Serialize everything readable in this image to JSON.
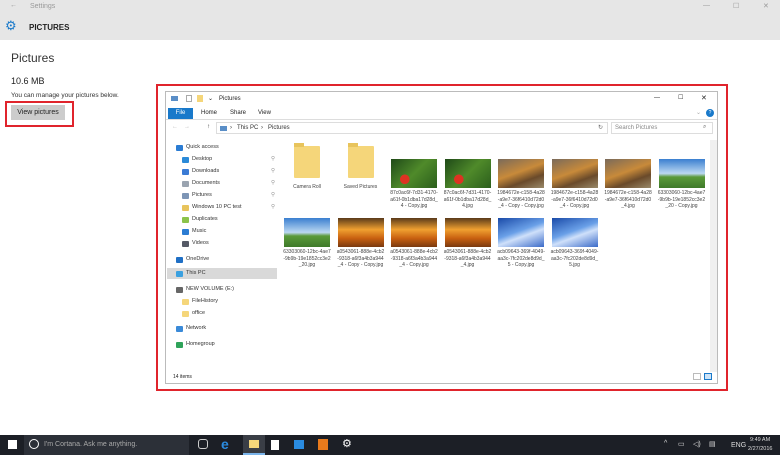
{
  "window": {
    "title": "Settings",
    "back_icon": "back-arrow-icon",
    "minimize": "—",
    "maximize": "☐",
    "close": "✕"
  },
  "header": {
    "title": "PICTURES",
    "icon": "gear-icon"
  },
  "main": {
    "heading": "Pictures",
    "size": "10.6 MB",
    "description": "You can manage your pictures below.",
    "button": "View pictures"
  },
  "explorer": {
    "title": "Pictures",
    "tabs": [
      "File",
      "Home",
      "Share",
      "View"
    ],
    "breadcrumb": [
      "This PC",
      "Pictures"
    ],
    "search_placeholder": "Search Pictures",
    "nav": [
      {
        "label": "Quick access",
        "color": "#2b7cd3",
        "indent": 0
      },
      {
        "label": "Desktop",
        "color": "#2b8ad8",
        "indent": 1,
        "pin": true
      },
      {
        "label": "Downloads",
        "color": "#3a7bd5",
        "indent": 1,
        "pin": true
      },
      {
        "label": "Documents",
        "color": "#9aa4b0",
        "indent": 1,
        "pin": true
      },
      {
        "label": "Pictures",
        "color": "#7d95b5",
        "indent": 1,
        "pin": true
      },
      {
        "label": "Windows 10 PC test",
        "color": "#e8c45c",
        "indent": 1,
        "pin": true
      },
      {
        "label": "Duplicates",
        "color": "#8bc34a",
        "indent": 1
      },
      {
        "label": "Music",
        "color": "#2b7cd3",
        "indent": 1
      },
      {
        "label": "Videos",
        "color": "#555a66",
        "indent": 1
      },
      {
        "label": "OneDrive",
        "color": "#1f6fc5",
        "indent": 0
      },
      {
        "label": "This PC",
        "color": "#3aa0e0",
        "indent": 0,
        "selected": true
      },
      {
        "label": "NEW VOLUME (E:)",
        "color": "#666",
        "indent": 0
      },
      {
        "label": "FileHistory",
        "color": "#f5d67a",
        "indent": 1
      },
      {
        "label": "office",
        "color": "#f5d67a",
        "indent": 1
      },
      {
        "label": "Network",
        "color": "#3a8ad8",
        "indent": 0
      },
      {
        "label": "Homegroup",
        "color": "#2fa35a",
        "indent": 0
      }
    ],
    "items": [
      {
        "name": "Camera Roll",
        "type": "folder"
      },
      {
        "name": "Saved Pictures",
        "type": "folder"
      },
      {
        "name": "87c0ac6f-7d31-4170-a61f-0b1dba17d28d_4 - Copy.jpg",
        "type": "green"
      },
      {
        "name": "87c0ac6f-7d31-4170-a61f-0b1dba17d28d_4.jpg",
        "type": "green"
      },
      {
        "name": "1984672e-c158-4a28-a9e7-36f6410d72d0_4 - Copy - Copy.jpg",
        "type": "fox"
      },
      {
        "name": "1984672e-c158-4a28-a9e7-36f6410d72d0_4 - Copy.jpg",
        "type": "fox"
      },
      {
        "name": "1984672e-c158-4a28-a9e7-36f6410d72d0_4.jpg",
        "type": "fox"
      },
      {
        "name": "63303060-12bc-4ae7-9b9b-19e1852cc3e2_20 - Copy.jpg",
        "type": "field"
      },
      {
        "name": "63303060-12bc-4ae7-9b9b-19e1852cc3e2_20.jpg",
        "type": "field"
      },
      {
        "name": "a0543061-888e-4cb2-9318-a6f3a4b3a944_4 - Copy - Copy.jpg",
        "type": "autumn"
      },
      {
        "name": "a0543061-888e-4cb2-9318-a6f3a4b3a944_4 - Copy.jpg",
        "type": "autumn"
      },
      {
        "name": "a0543061-888e-4cb2-9318-a6f3a4b3a944_4.jpg",
        "type": "autumn"
      },
      {
        "name": "acb09643-369f-4049-aa3c-7fc202de8d9d_5 - Copy.jpg",
        "type": "ice"
      },
      {
        "name": "acb09643-369f-4049-aa3c-7fc202de8d9d_5.jpg",
        "type": "ice"
      }
    ],
    "status": "14 items"
  },
  "taskbar": {
    "cortana": "I'm Cortana. Ask me anything.",
    "lang": "ENG",
    "time": "9:49 AM",
    "date": "2/27/2016"
  },
  "colors": {
    "accent": "#1979ca",
    "highlight": "#e0242c"
  }
}
